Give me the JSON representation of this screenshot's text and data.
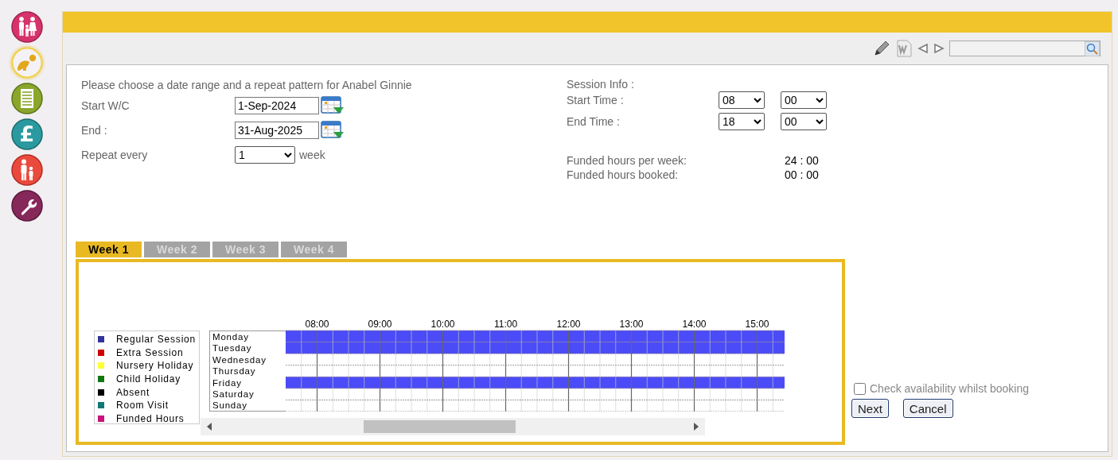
{
  "sidebar": {
    "items": [
      {
        "kind": "family",
        "selected": false
      },
      {
        "kind": "baby",
        "selected": true
      },
      {
        "kind": "document",
        "selected": false
      },
      {
        "kind": "money",
        "symbol": "£",
        "selected": false
      },
      {
        "kind": "parent",
        "selected": false
      },
      {
        "kind": "tools",
        "selected": false
      }
    ]
  },
  "form": {
    "intro": "Please choose a date range and a repeat pattern for Anabel Ginnie",
    "start": {
      "label": "Start W/C",
      "value": "1-Sep-2024"
    },
    "end": {
      "label": "End :",
      "value": "31-Aug-2025"
    },
    "repeat": {
      "label": "Repeat every",
      "value": "1",
      "unit": "week"
    }
  },
  "session_info": {
    "title": "Session Info :",
    "times": [
      {
        "label": "Start Time :",
        "hour": "08",
        "minute": "00"
      },
      {
        "label": "End Time :",
        "hour": "18",
        "minute": "00"
      }
    ],
    "funded": [
      {
        "label": "Funded hours per week:",
        "value": "24 : 00"
      },
      {
        "label": "Funded hours booked:",
        "value": "00 : 00"
      }
    ]
  },
  "tabs": [
    {
      "label": "Week 1",
      "selected": true
    },
    {
      "label": "Week 2",
      "selected": false
    },
    {
      "label": "Week 3",
      "selected": false
    },
    {
      "label": "Week 4",
      "selected": false
    }
  ],
  "legend": [
    {
      "label": "Regular Session",
      "color": "#333399"
    },
    {
      "label": "Extra Session",
      "color": "#cc0000"
    },
    {
      "label": "Nursery Holiday",
      "color": "#ffff33"
    },
    {
      "label": "Child Holiday",
      "color": "#117711"
    },
    {
      "label": "Absent",
      "color": "#000000"
    },
    {
      "label": "Room Visit",
      "color": "#117777"
    },
    {
      "label": "Funded Hours",
      "color": "#cc1177"
    }
  ],
  "schedule": {
    "hours": [
      "08:00",
      "09:00",
      "10:00",
      "11:00",
      "12:00",
      "13:00",
      "14:00",
      "15:00"
    ],
    "days": [
      {
        "label": "Monday",
        "booked": true
      },
      {
        "label": "Tuesday",
        "booked": true
      },
      {
        "label": "Wednesday",
        "booked": false
      },
      {
        "label": "Thursday",
        "booked": false
      },
      {
        "label": "Friday",
        "booked": true
      },
      {
        "label": "Saturday",
        "booked": false
      },
      {
        "label": "Sunday",
        "booked": false
      }
    ]
  },
  "check_availability": {
    "label": "Check availability whilst booking",
    "checked": false
  },
  "buttons": [
    "Next",
    "Cancel"
  ]
}
